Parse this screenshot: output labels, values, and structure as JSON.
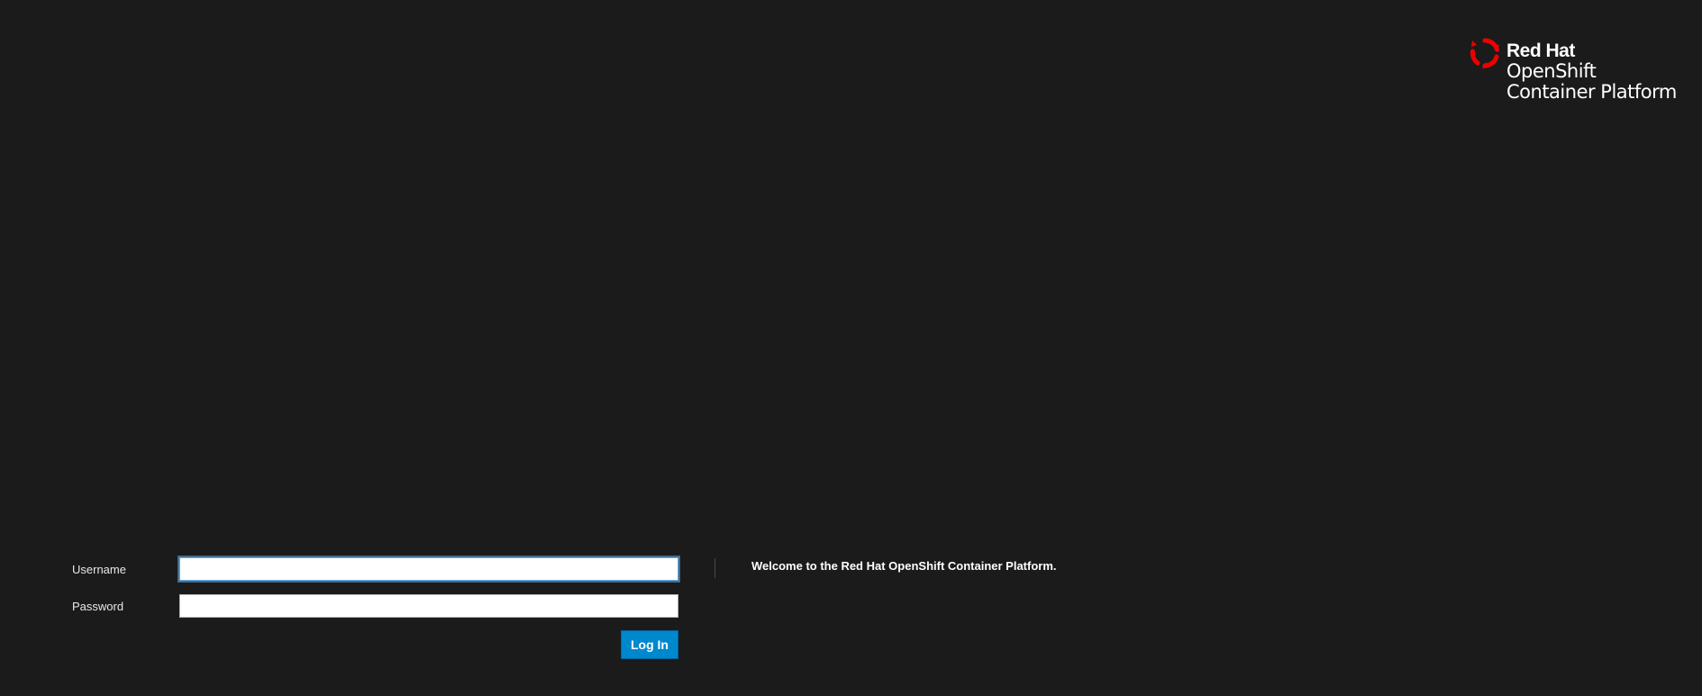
{
  "brand": {
    "icon": "redhat-logo-icon",
    "line1": "Red Hat",
    "line2": "OpenShift",
    "line3": "Container Platform",
    "icon_color": "#ee0000"
  },
  "login": {
    "username_label": "Username",
    "username_value": "",
    "password_label": "Password",
    "password_value": "",
    "submit_label": "Log In"
  },
  "welcome": {
    "message": "Welcome to the Red Hat OpenShift Container Platform."
  },
  "colors": {
    "background": "#1b1b1b",
    "accent": "#0088ce",
    "focus": "#66afe9"
  }
}
